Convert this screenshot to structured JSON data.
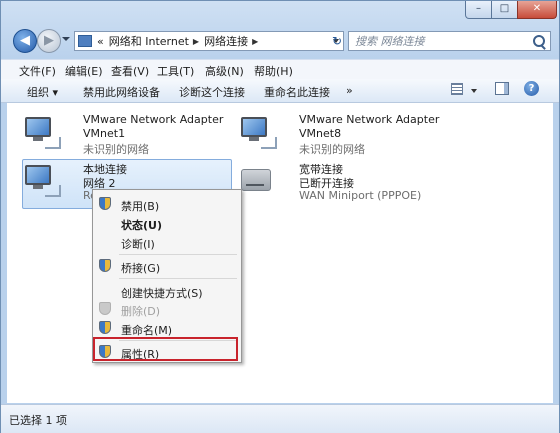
{
  "window": {
    "minimize": "–",
    "maximize": "□",
    "close": "✕"
  },
  "nav": {
    "back": "◀",
    "forward": "▶",
    "refresh": "↻"
  },
  "address": {
    "prefix": "«",
    "crumbs": [
      "网络和 Internet",
      "网络连接"
    ]
  },
  "search": {
    "placeholder": "搜索 网络连接"
  },
  "menu": [
    "文件(F)",
    "编辑(E)",
    "查看(V)",
    "工具(T)",
    "高级(N)",
    "帮助(H)"
  ],
  "commands": [
    "组织 ▾",
    "禁用此网络设备",
    "诊断这个连接",
    "重命名此连接",
    "»"
  ],
  "connections": [
    {
      "name": "VMware Network Adapter",
      "sub": "VMnet1",
      "dev": "未识别的网络"
    },
    {
      "name": "VMware Network Adapter",
      "sub": "VMnet8",
      "dev": "未识别的网络"
    },
    {
      "name": "本地连接",
      "sub": "网络 2",
      "dev": "Real"
    },
    {
      "name": "宽带连接",
      "sub": "已断开连接",
      "dev": "WAN Miniport (PPPOE)"
    }
  ],
  "context_menu": [
    "禁用(B)",
    "状态(U)",
    "诊断(I)",
    "桥接(G)",
    "创建快捷方式(S)",
    "删除(D)",
    "重命名(M)",
    "属性(R)"
  ],
  "status": "已选择 1 项",
  "help": "?"
}
